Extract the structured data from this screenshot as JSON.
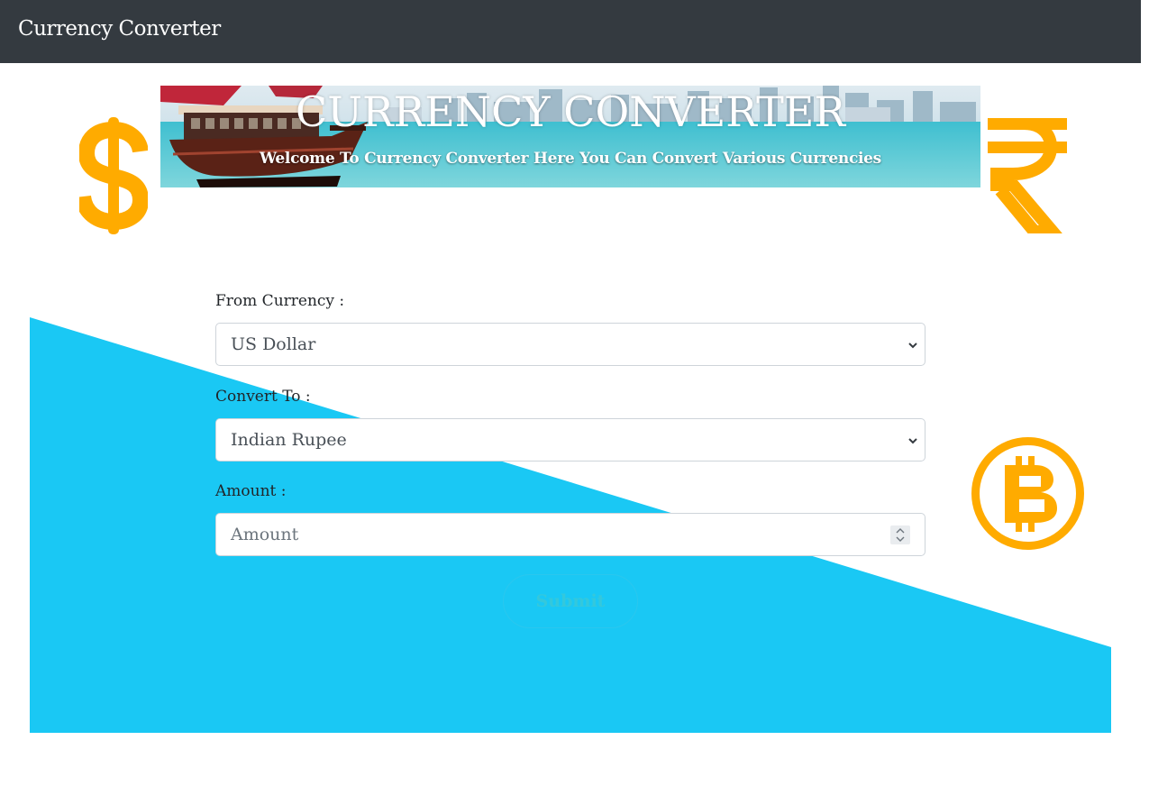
{
  "navbar": {
    "brand": "Currency Converter"
  },
  "banner": {
    "title": "CURRENCY CONVERTER",
    "subtitle": "Welcome To Currency Converter Here You Can Convert Various Currencies"
  },
  "icons": {
    "left": "dollar-icon",
    "right": "rupee-icon",
    "side": "bitcoin-icon",
    "accent_color": "#ffab00"
  },
  "form": {
    "from_label": "From Currency :",
    "from_value": "US Dollar",
    "to_label": "Convert To :",
    "to_value": "Indian Rupee",
    "amount_label": "Amount :",
    "amount_placeholder": "Amount",
    "submit_label": "Submit"
  },
  "colors": {
    "navbar": "#343a40",
    "background_shape": "#1ac8f4",
    "icons": "#ffab00"
  }
}
